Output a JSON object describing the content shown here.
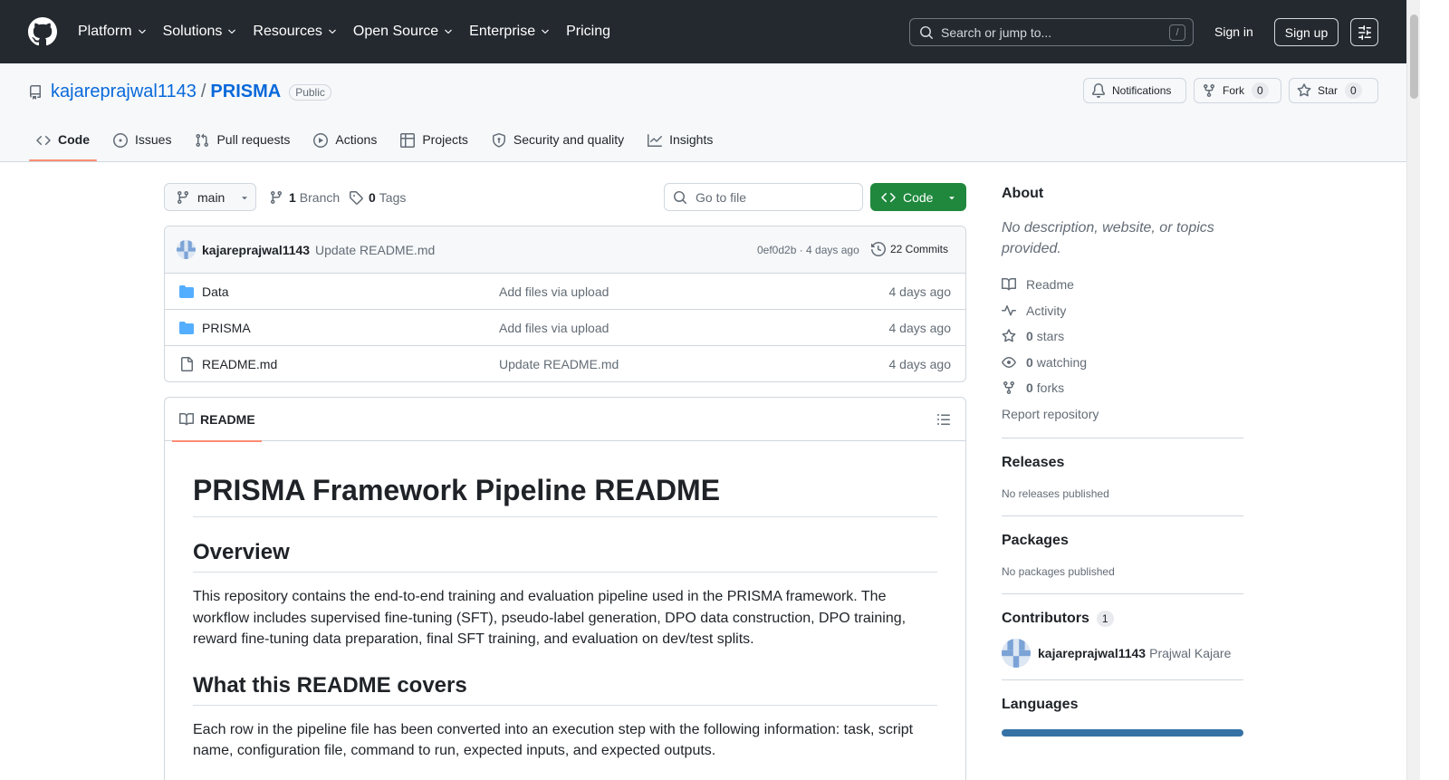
{
  "header": {
    "nav": [
      "Platform",
      "Solutions",
      "Resources",
      "Open Source",
      "Enterprise",
      "Pricing"
    ],
    "search_placeholder": "Search or jump to...",
    "search_key": "/",
    "signin": "Sign in",
    "signup": "Sign up"
  },
  "repo": {
    "owner": "kajareprajwal1143",
    "separator": "/",
    "name": "PRISMA",
    "visibility": "Public",
    "notifications": "Notifications",
    "fork_label": "Fork",
    "fork_count": "0",
    "star_label": "Star",
    "star_count": "0"
  },
  "tabs": [
    {
      "label": "Code",
      "icon": "code-icon",
      "active": true
    },
    {
      "label": "Issues",
      "icon": "issue-icon"
    },
    {
      "label": "Pull requests",
      "icon": "pull-request-icon"
    },
    {
      "label": "Actions",
      "icon": "play-icon"
    },
    {
      "label": "Projects",
      "icon": "table-icon"
    },
    {
      "label": "Security and quality",
      "icon": "shield-icon"
    },
    {
      "label": "Insights",
      "icon": "graph-icon"
    }
  ],
  "branchbar": {
    "branch": "main",
    "branch_count": "1",
    "branch_label": "Branch",
    "tag_count": "0",
    "tag_label": "Tags",
    "goto_placeholder": "Go to file",
    "code_button": "Code"
  },
  "commit": {
    "author": "kajareprajwal1143",
    "message": "Update README.md",
    "meta": "0ef0d2b · 4 days ago",
    "commits": "22 Commits"
  },
  "files": [
    {
      "name": "Data",
      "type": "folder",
      "message": "Add files via upload",
      "age": "4 days ago"
    },
    {
      "name": "PRISMA",
      "type": "folder",
      "message": "Add files via upload",
      "age": "4 days ago"
    },
    {
      "name": "README.md",
      "type": "file",
      "message": "Update README.md",
      "age": "4 days ago"
    }
  ],
  "readme": {
    "tab": "README",
    "h1": "PRISMA Framework Pipeline README",
    "h2_overview": "Overview",
    "p_overview": "This repository contains the end-to-end training and evaluation pipeline used in the PRISMA framework. The workflow includes supervised fine-tuning (SFT), pseudo-label generation, DPO data construction, DPO training, reward fine-tuning data preparation, final SFT training, and evaluation on dev/test splits.",
    "h2_covers": "What this README covers",
    "p_covers": "Each row in the pipeline file has been converted into an execution step with the following information: task, script name, configuration file, command to run, expected inputs, and expected outputs."
  },
  "sidebar": {
    "about_title": "About",
    "about_desc": "No description, website, or topics provided.",
    "readme": "Readme",
    "activity": "Activity",
    "stars_count": "0",
    "stars_label": "stars",
    "watching_count": "0",
    "watching_label": "watching",
    "forks_count": "0",
    "forks_label": "forks",
    "report": "Report repository",
    "releases_title": "Releases",
    "releases_text": "No releases published",
    "packages_title": "Packages",
    "packages_text": "No packages published",
    "contributors_title": "Contributors",
    "contributors_count": "1",
    "contributor_login": "kajareprajwal1143",
    "contributor_name": "Prajwal Kajare",
    "languages_title": "Languages"
  },
  "colors": {
    "header_bg": "#24292f",
    "link": "#0969da",
    "primary_button": "#1f883d",
    "tab_underline": "#fd8c73",
    "language_bar": "#3572a5"
  }
}
